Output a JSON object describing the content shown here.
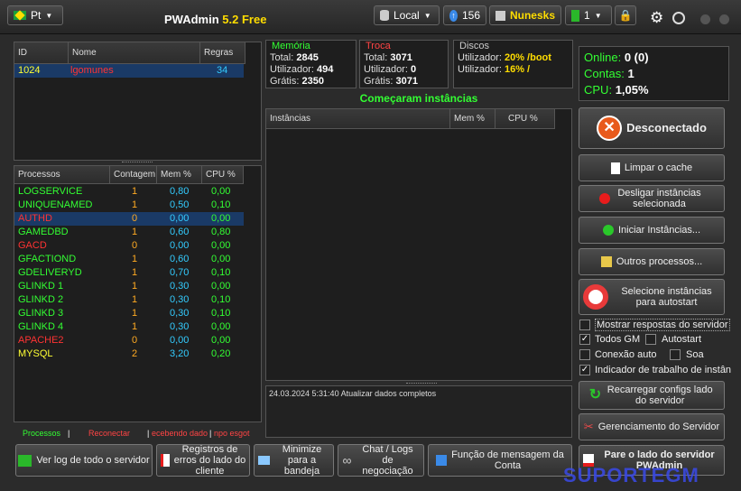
{
  "topbar": {
    "lang": "Pt",
    "title": "PWAdmin",
    "version": "5.2 Free",
    "server": "Local",
    "online_count": "156",
    "user": "Nunesks",
    "level": "1"
  },
  "accounts": {
    "headers": [
      "ID",
      "Nome",
      "Regras"
    ],
    "rows": [
      {
        "id": "1024",
        "name": "lgomunes",
        "rules": "34"
      }
    ]
  },
  "processes": {
    "headers": [
      "Processos",
      "Contagem",
      "Mem %",
      "CPU %"
    ],
    "rows": [
      {
        "name": "LOGSERVICE",
        "count": "1",
        "mem": "0,80",
        "cpu": "0,00",
        "color": "#33ff33"
      },
      {
        "name": "UNIQUENAMED",
        "count": "1",
        "mem": "0,50",
        "cpu": "0,10",
        "color": "#33ff33"
      },
      {
        "name": "AUTHD",
        "count": "0",
        "mem": "0,00",
        "cpu": "0,00",
        "color": "#ff3333"
      },
      {
        "name": "GAMEDBD",
        "count": "1",
        "mem": "0,60",
        "cpu": "0,80",
        "color": "#33ff33"
      },
      {
        "name": "GACD",
        "count": "0",
        "mem": "0,00",
        "cpu": "0,00",
        "color": "#ff3333"
      },
      {
        "name": "GFACTIOND",
        "count": "1",
        "mem": "0,60",
        "cpu": "0,00",
        "color": "#33ff33"
      },
      {
        "name": "GDELIVERYD",
        "count": "1",
        "mem": "0,70",
        "cpu": "0,10",
        "color": "#33ff33"
      },
      {
        "name": "GLINKD 1",
        "count": "1",
        "mem": "0,30",
        "cpu": "0,00",
        "color": "#33ff33"
      },
      {
        "name": "GLINKD 2",
        "count": "1",
        "mem": "0,30",
        "cpu": "0,10",
        "color": "#33ff33"
      },
      {
        "name": "GLINKD 3",
        "count": "1",
        "mem": "0,30",
        "cpu": "0,10",
        "color": "#33ff33"
      },
      {
        "name": "GLINKD 4",
        "count": "1",
        "mem": "0,30",
        "cpu": "0,00",
        "color": "#33ff33"
      },
      {
        "name": "APACHE2",
        "count": "0",
        "mem": "0,00",
        "cpu": "0,00",
        "color": "#ff3333"
      },
      {
        "name": "MYSQL",
        "count": "2",
        "mem": "3,20",
        "cpu": "0,20",
        "color": "#ffff33"
      }
    ]
  },
  "legend": {
    "processos": "Processos",
    "reconectar": "Reconectar",
    "recebendo": "ecebendo dado",
    "espera": "npo esgot"
  },
  "memory": {
    "title": "Memória",
    "total_l": "Total:",
    "total": "2845",
    "used_l": "Utilizador:",
    "used": "494",
    "free_l": "Grátis:",
    "free": "2350"
  },
  "swap": {
    "title": "Troca",
    "total_l": "Total:",
    "total": "3071",
    "used_l": "Utilizador:",
    "used": "0",
    "free_l": "Grátis:",
    "free": "3071"
  },
  "disks": {
    "title": "Discos",
    "l1": "Utilizador:",
    "v1": "20% /boot",
    "l2": "Utilizador:",
    "v2": "16% /"
  },
  "stats": {
    "online_l": "Online:",
    "online": "0 (0)",
    "contas_l": "Contas:",
    "contas": "1",
    "cpu_l": "CPU:",
    "cpu": "1,05%"
  },
  "instances": {
    "status": "Começaram instâncias",
    "headers": [
      "Instâncias",
      "Mem %",
      "CPU %"
    ]
  },
  "log": {
    "line": "24.03.2024 5:31:40 Atualizar dados completos"
  },
  "right": {
    "disconnected": "Desconectado",
    "clear_cache": "Limpar o cache",
    "stop_instances": "Desligar instâncias selecionada",
    "start_instances": "Iniciar Instâncias...",
    "other_processes": "Outros processos...",
    "autostart": "Selecione instâncias para autostart",
    "chk_show": "Mostrar respostas do servidor",
    "chk_all_gm": "Todos GM",
    "chk_autostart": "Autostart",
    "chk_auto_conn": "Conexão auto",
    "chk_sound": "Soa",
    "chk_indicator": "Indicador de trabalho de instân",
    "reload": "Recarregar configs lado do servidor",
    "manage": "Gerenciamento do Servidor",
    "stop_server": "Pare o lado do servidor PWAdmin"
  },
  "bottom": {
    "log": "Ver log de todo o servidor",
    "errors": "Registros de erros do lado do cliente",
    "minimize": "Minimize para a bandeja",
    "chat": "Chat / Logs de negociação",
    "msg": "Função de mensagem da Conta"
  },
  "watermark": "SUPORTEGM"
}
